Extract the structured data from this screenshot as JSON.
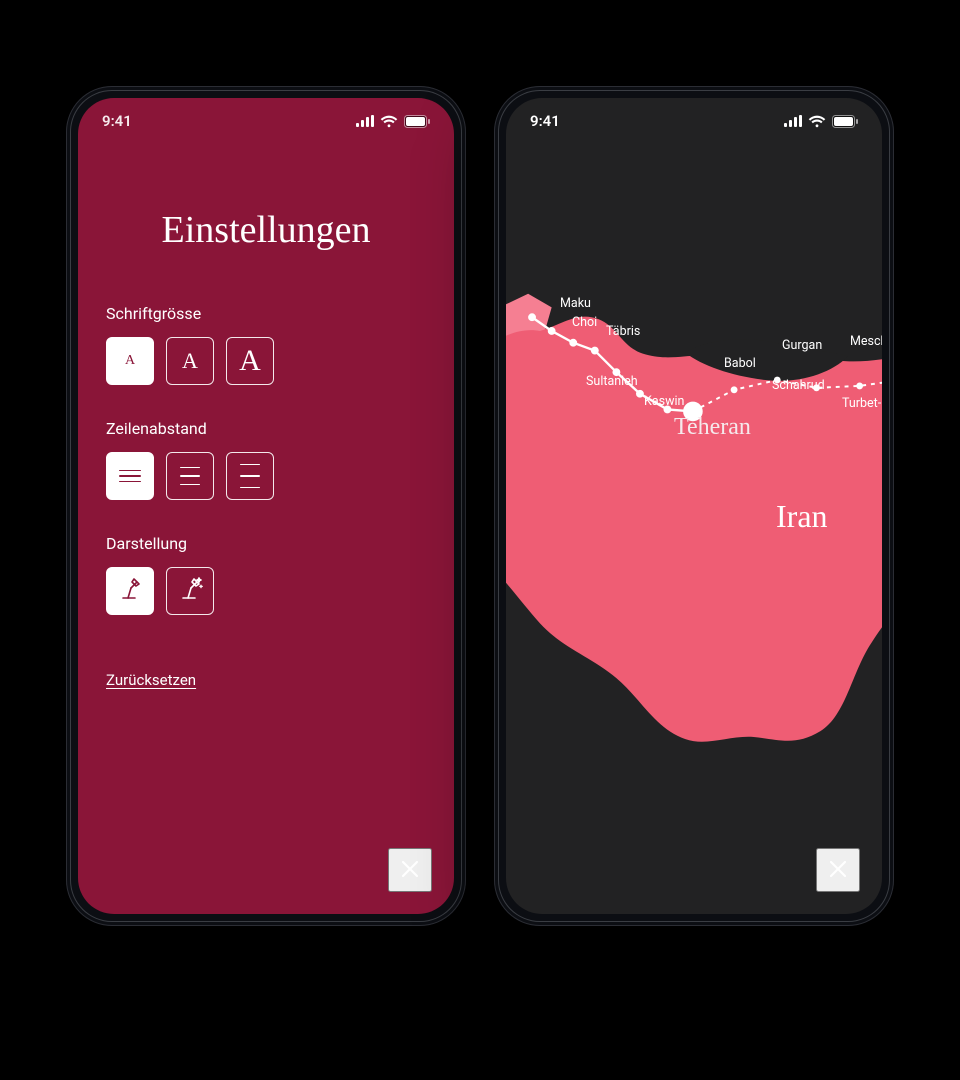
{
  "status": {
    "time": "9:41"
  },
  "settings": {
    "title": "Einstellungen",
    "font_size": {
      "label": "Schriftgrösse",
      "glyph": "A"
    },
    "line_spacing": {
      "label": "Zeilenabstand"
    },
    "appearance": {
      "label": "Darstellung"
    },
    "reset": "Zurücksetzen"
  },
  "map": {
    "country": "Iran",
    "cities": {
      "maku": "Maku",
      "choi": "Choi",
      "tabris": "Täbris",
      "sultanieh": "Sultanieh",
      "kaswin": "Kaswin",
      "teheran": "Teheran",
      "babol": "Babol",
      "gurgan": "Gurgan",
      "schahrud": "Schahrud",
      "mesch": "Mesch",
      "turbet": "Turbet-"
    }
  }
}
